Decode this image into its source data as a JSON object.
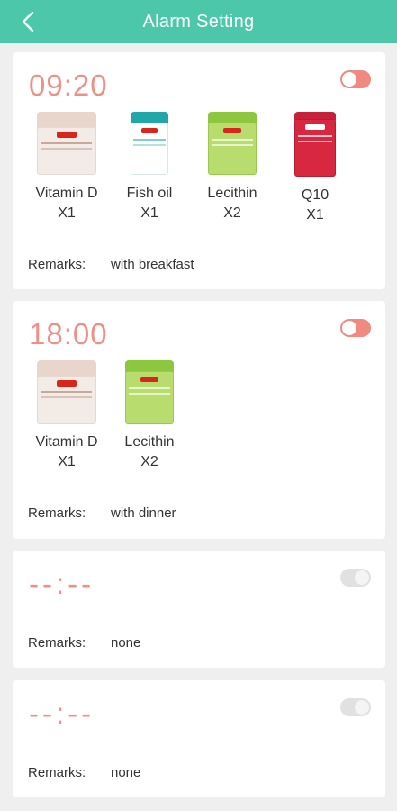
{
  "header": {
    "title": "Alarm Setting"
  },
  "colors": {
    "accent": "#4dc7a9",
    "time": "#ef8f86",
    "toggle_red": "#f08a80",
    "toggle_grey": "#e1e1e1"
  },
  "alarms": [
    {
      "time": "09:20",
      "toggle": "off",
      "meds": [
        {
          "name": "Vitamin D",
          "qty": "X1",
          "icon": "vitamin-d-bottle"
        },
        {
          "name": "Fish oil",
          "qty": "X1",
          "icon": "fish-oil-bottle"
        },
        {
          "name": "Lecithin",
          "qty": "X2",
          "icon": "lecithin-bottle"
        },
        {
          "name": "Q10",
          "qty": "X1",
          "icon": "q10-bottle"
        }
      ],
      "remarks_label": "Remarks:",
      "remarks_value": "with breakfast"
    },
    {
      "time": "18:00",
      "toggle": "off",
      "meds": [
        {
          "name": "Vitamin D",
          "qty": "X1",
          "icon": "vitamin-d-bottle"
        },
        {
          "name": "Lecithin",
          "qty": "X2",
          "icon": "lecithin-bottle"
        }
      ],
      "remarks_label": "Remarks:",
      "remarks_value": "with dinner"
    },
    {
      "time": "--:--",
      "toggle": "disabled",
      "meds": [],
      "remarks_label": "Remarks:",
      "remarks_value": "none"
    },
    {
      "time": "--:--",
      "toggle": "disabled",
      "meds": [],
      "remarks_label": "Remarks:",
      "remarks_value": "none"
    }
  ]
}
